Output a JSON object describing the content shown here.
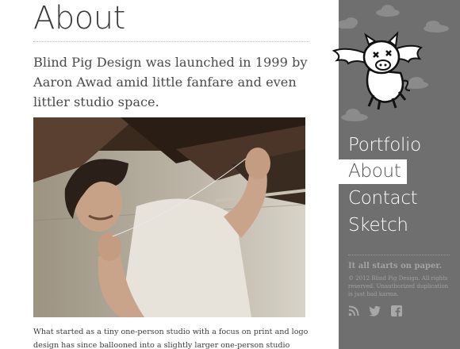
{
  "page": {
    "title": "About",
    "intro": "Blind Pig Design was launched in 1999 by Aaron Awad amid little fanfare and even littler studio space.",
    "body": "What started as a tiny one-person studio with a focus on print and logo design has since ballooned into a slightly larger one-person studio specializing in hand-"
  },
  "sidebar": {
    "logo_icon": "flying-pig-logo-icon",
    "nav": [
      {
        "label": "Portfolio",
        "active": false
      },
      {
        "label": "About",
        "active": true
      },
      {
        "label": "Contact",
        "active": false
      },
      {
        "label": "Sketch",
        "active": false
      }
    ],
    "tagline": "It all starts on paper.",
    "copyright": "© 2012 Blind Pig Design. All rights reserved. Unauthorized duplication is just bad karma.",
    "social": [
      "rss-icon",
      "twitter-icon",
      "facebook-icon"
    ]
  },
  "colors": {
    "sidebar_bg": "#6f6f6f",
    "nav_active_bg": "#ffffff",
    "text": "#4a4a4a"
  }
}
